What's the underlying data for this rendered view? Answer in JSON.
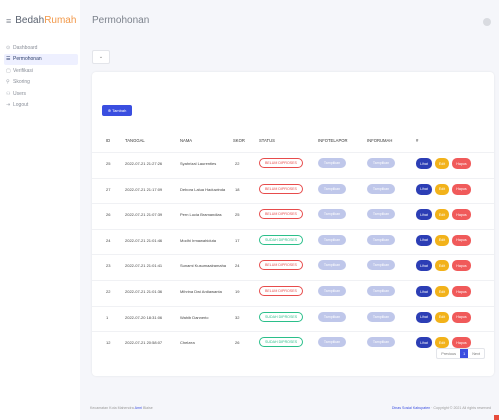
{
  "brand": {
    "part1": "Bedah",
    "part2": "Rumah"
  },
  "sidebar": {
    "items": [
      {
        "icon": "⊙",
        "label": "Dashboard",
        "active": false
      },
      {
        "icon": "☰",
        "label": "Permohonan",
        "active": true
      },
      {
        "icon": "▢",
        "label": "Verifikasi",
        "active": false
      },
      {
        "icon": "⚲",
        "label": "Skoring",
        "active": false
      },
      {
        "icon": "⚇",
        "label": "Users",
        "active": false
      },
      {
        "icon": "⇥",
        "label": "Logout",
        "active": false
      }
    ]
  },
  "header": {
    "title": "Permohonan"
  },
  "filter": {
    "caret": "⌄"
  },
  "toolbar": {
    "add_label": "⊕ Tambah"
  },
  "table": {
    "headers": [
      "ID",
      "TANGGAL",
      "NAMA",
      "SKOR",
      "STATUS",
      "INFOTELAPOR",
      "INFORUMAH",
      "#"
    ],
    "rows": [
      {
        "id": "25",
        "tanggal": "2022-07-21 21:27:26",
        "nama": "Syahrizal Laurenties",
        "skor": "22",
        "status": "BELUM DIPROSES",
        "status_type": "red",
        "infotelapor": "Tampilkan",
        "inforumah": "Tampilkan"
      },
      {
        "id": "27",
        "tanggal": "2022-07-21 21:17:09",
        "nama": "Debora Lalua Haduwinda",
        "skor": "18",
        "status": "BELUM DIPROSES",
        "status_type": "red",
        "infotelapor": "Tampilkan",
        "inforumah": "Tampilkan"
      },
      {
        "id": "26",
        "tanggal": "2022-07-21 21:07:39",
        "nama": "Pern Lucia Bramandias",
        "skor": "25",
        "status": "BELUM DIPROSES",
        "status_type": "red",
        "infotelapor": "Tampilkan",
        "inforumah": "Tampilkan"
      },
      {
        "id": "24",
        "tanggal": "2022-07-21 21:01:46",
        "nama": "Modhi Irmawahiduta",
        "skor": "17",
        "status": "SUDAH DIPROSES",
        "status_type": "green",
        "infotelapor": "Tampilkan",
        "inforumah": "Tampilkan"
      },
      {
        "id": "23",
        "tanggal": "2022-07-21 21:01:41",
        "nama": "Sunami Kusumaalramaha",
        "skor": "24",
        "status": "BELUM DIPROSES",
        "status_type": "red",
        "infotelapor": "Tampilkan",
        "inforumah": "Tampilkan"
      },
      {
        "id": "22",
        "tanggal": "2022-07-21 21:01:36",
        "nama": "Mihrina Dwi Ardiawanta",
        "skor": "19",
        "status": "BELUM DIPROSES",
        "status_type": "red",
        "infotelapor": "Tampilkan",
        "inforumah": "Tampilkan"
      },
      {
        "id": "1",
        "tanggal": "2022-07-20 18:31:06",
        "nama": "Wahib Dannerio",
        "skor": "32",
        "status": "SUDAH DIPROSES",
        "status_type": "green",
        "infotelapor": "Tampilkan",
        "inforumah": "Tampilkan"
      },
      {
        "id": "12",
        "tanggal": "2022-07-21 20:58:07",
        "nama": "Chelzea",
        "skor": "26",
        "status": "SUDAH DIPROSES",
        "status_type": "green",
        "infotelapor": "Tampilkan",
        "inforumah": "Tampilkan"
      }
    ],
    "actions": {
      "view": "Lihat",
      "edit": "Edit",
      "delete": "Hapus"
    }
  },
  "pagination": {
    "prev": "Previous",
    "current": "1",
    "next": "Next"
  },
  "footer": {
    "left_prefix": "Kecamatan Kota Mahendra ",
    "left_accent": "Amri",
    "left_suffix": " Blaise",
    "right_accent": "Dinas Sosial Kabupaten",
    "right_rest": " · Copyright © 2021 All rights reserved"
  },
  "colors": {
    "primary": "#3a4ee0",
    "brand_accent": "#f2994a",
    "danger": "#e74c4c",
    "success": "#2bbf8a",
    "warning": "#f2b21a"
  }
}
